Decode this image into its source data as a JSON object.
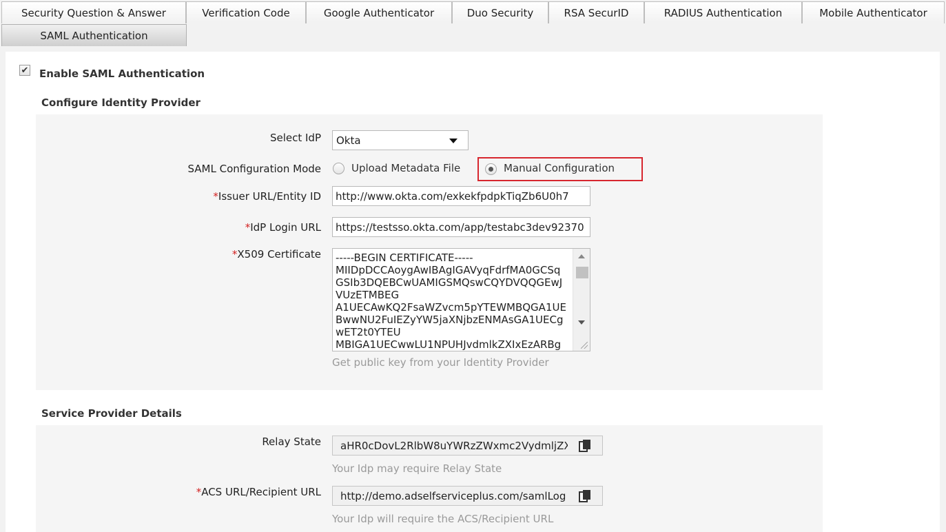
{
  "tabs": [
    {
      "label": "Security Question & Answer"
    },
    {
      "label": "Verification Code"
    },
    {
      "label": "Google Authenticator"
    },
    {
      "label": "Duo Security"
    },
    {
      "label": "RSA SecurID"
    },
    {
      "label": "RADIUS Authentication"
    },
    {
      "label": "Mobile Authenticator"
    },
    {
      "label": "SAML Authentication",
      "active": true
    }
  ],
  "enable_saml": {
    "label": "Enable SAML Authentication",
    "checked": true
  },
  "idp_section": {
    "title": "Configure Identity Provider",
    "select_idp": {
      "label": "Select IdP",
      "value": "Okta"
    },
    "config_mode": {
      "label": "SAML Configuration Mode",
      "options": [
        {
          "label": "Upload Metadata File",
          "selected": false
        },
        {
          "label": "Manual Configuration",
          "selected": true
        }
      ]
    },
    "issuer": {
      "required_mark": "*",
      "label": "Issuer URL/Entity ID",
      "value": "http://www.okta.com/exkekfpdpkTiqZb6U0h7"
    },
    "login_url": {
      "required_mark": "*",
      "label": "IdP Login URL",
      "value": "https://testsso.okta.com/app/testabc3dev92370"
    },
    "certificate": {
      "required_mark": "*",
      "label": "X509 Certificate",
      "value": "-----BEGIN CERTIFICATE-----\nMIIDpDCCAoygAwIBAgIGAVyqFdrfMA0GCSq\nGSIb3DQEBCwUAMIGSMQswCQYDVQQGEwJ\nVUzETMBEG\nA1UECAwKQ2FsaWZvcm5pYTEWMBQGA1UE\nBwwNU2FuIEZyYW5jaXNjbzENMAsGA1UECg\nwET2t0YTEU\nMBIGA1UECwwLU1NPUHJvdmlkZXIxEzARBg",
      "hint": "Get public key from your Identity Provider"
    }
  },
  "sp_section": {
    "title": "Service Provider Details",
    "relay_state": {
      "label": "Relay State",
      "value": "aHR0cDovL2RlbW8uYWRzZWxmc2VydmljZX",
      "hint": "Your Idp may require Relay State"
    },
    "acs_url": {
      "required_mark": "*",
      "label": "ACS URL/Recipient URL",
      "value": "http://demo.adselfserviceplus.com/samlLog",
      "hint": "Your Idp will require the ACS/Recipient URL"
    }
  },
  "colors": {
    "required": "#d21f1f",
    "highlight": "#d7262e",
    "hint": "#9a9a9a"
  }
}
